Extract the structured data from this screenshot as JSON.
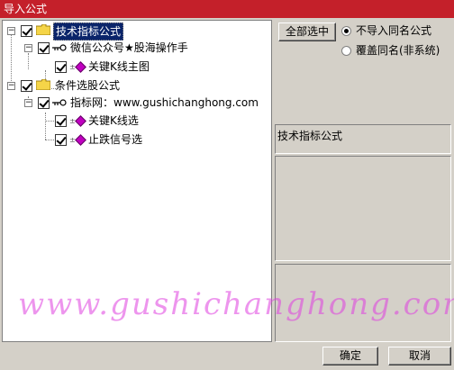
{
  "window": {
    "title": "导入公式"
  },
  "tree": {
    "groups": [
      {
        "label": "技术指标公式",
        "children": [
          {
            "label": "微信公众号★股海操作手",
            "items": [
              {
                "label": "关键K线主图"
              }
            ]
          }
        ]
      },
      {
        "label": "条件选股公式",
        "children": [
          {
            "label": "指标网：www.gushichanghong.com",
            "items": [
              {
                "label": "关键K线选"
              },
              {
                "label": "止跌信号选"
              }
            ]
          }
        ]
      }
    ]
  },
  "options": {
    "select_all_label": "全部选中",
    "radio_no_import_label": "不导入同名公式",
    "radio_overwrite_label": "覆盖同名(非系统)",
    "selected_radio": "no_import"
  },
  "info": {
    "title": "技术指标公式"
  },
  "buttons": {
    "ok_label": "确定",
    "cancel_label": "取消"
  },
  "watermark": {
    "text": "www.gushichanghong.com"
  }
}
